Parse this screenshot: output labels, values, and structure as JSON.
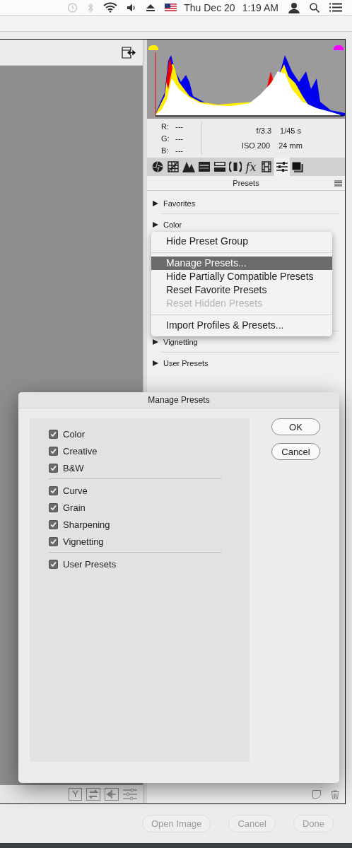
{
  "menubar": {
    "date": "Thu Dec 20",
    "time": "1:19 AM"
  },
  "camera_info": {
    "rgb": [
      {
        "label": "R:",
        "value": "---"
      },
      {
        "label": "G:",
        "value": "---"
      },
      {
        "label": "B:",
        "value": "---"
      }
    ],
    "aperture": "f/3.3",
    "shutter": "1/45 s",
    "iso": "ISO 200",
    "focal_length": "24 mm"
  },
  "tool_tabs": [
    {
      "selected": false
    },
    {
      "selected": false
    },
    {
      "selected": false
    },
    {
      "selected": false
    },
    {
      "selected": false
    },
    {
      "selected": false
    },
    {
      "selected": false,
      "label": "fx"
    },
    {
      "selected": false
    },
    {
      "selected": true
    },
    {
      "selected": false
    }
  ],
  "presets_panel": {
    "title": "Presets",
    "groups": [
      {
        "label": "Favorites"
      },
      {
        "label": "Color"
      },
      {
        "label": "Vignetting"
      },
      {
        "label": "User Presets"
      }
    ]
  },
  "bottom_tools": {
    "sampler_label": "Y"
  },
  "context_menu": {
    "items": [
      {
        "label": "Hide Preset Group",
        "selected": false,
        "disabled": false,
        "separator_before": false
      },
      {
        "label": "Manage Presets...",
        "selected": true,
        "disabled": false,
        "separator_before": true
      },
      {
        "label": "Hide Partially Compatible Presets",
        "selected": false,
        "disabled": false,
        "separator_before": false
      },
      {
        "label": "Reset Favorite Presets",
        "selected": false,
        "disabled": false,
        "separator_before": false
      },
      {
        "label": "Reset Hidden Presets",
        "selected": false,
        "disabled": true,
        "separator_before": false
      },
      {
        "label": "Import Profiles & Presets...",
        "selected": false,
        "disabled": false,
        "separator_before": true
      }
    ]
  },
  "dialog": {
    "title": "Manage Presets",
    "groups": [
      [
        {
          "label": "Color",
          "checked": true
        },
        {
          "label": "Creative",
          "checked": true
        },
        {
          "label": "B&W",
          "checked": true
        }
      ],
      [
        {
          "label": "Curve",
          "checked": true
        },
        {
          "label": "Grain",
          "checked": true
        },
        {
          "label": "Sharpening",
          "checked": true
        },
        {
          "label": "Vignetting",
          "checked": true
        }
      ],
      [
        {
          "label": "User Presets",
          "checked": true
        }
      ]
    ],
    "buttons": [
      "OK",
      "Cancel"
    ]
  },
  "footer_buttons": [
    {
      "label": "Open Image",
      "disabled": true
    },
    {
      "label": "Cancel",
      "disabled": true
    },
    {
      "label": "Done",
      "disabled": true
    }
  ]
}
